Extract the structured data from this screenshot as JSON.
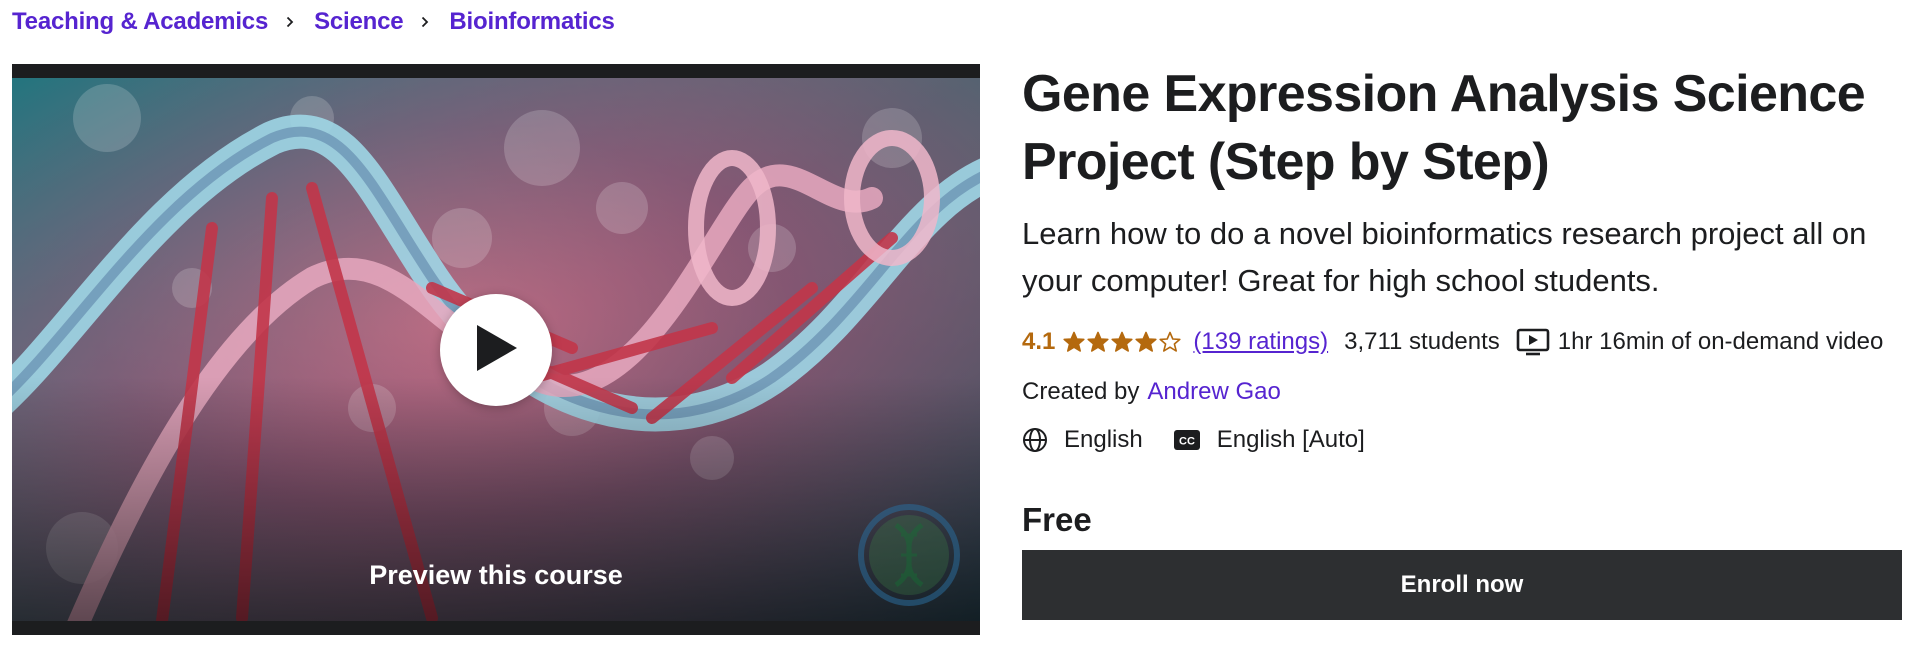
{
  "breadcrumb": [
    "Teaching & Academics",
    "Science",
    "Bioinformatics"
  ],
  "preview": {
    "label": "Preview this course"
  },
  "course": {
    "title": "Gene Expression Analysis Science Project (Step by Step)",
    "subtitle": "Learn how to do a novel bioinformatics research project all on your computer! Great for high school students.",
    "rating": "4.1",
    "rating_value": 4.1,
    "stars_total": 5,
    "ratings_count": "(139 ratings)",
    "students": "3,711 students",
    "video": "1hr 16min of on-demand video",
    "created_by_label": "Created by",
    "instructor": "Andrew Gao",
    "language": "English",
    "captions": "English [Auto]",
    "price": "Free",
    "enroll_label": "Enroll now"
  },
  "colors": {
    "accent": "#5624d0",
    "rating": "#b4690e",
    "button": "#2d2f31"
  },
  "icons": [
    "chevron-right-icon",
    "play-icon",
    "star-icon",
    "video-icon",
    "globe-icon",
    "closed-captions-icon",
    "dna-icon"
  ]
}
